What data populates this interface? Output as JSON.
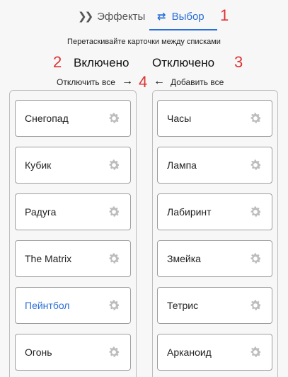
{
  "tabs": [
    {
      "label": "Эффекты",
      "icon": "double-chevron-right-icon"
    },
    {
      "label": "Выбор",
      "icon": "swap-arrows-icon"
    }
  ],
  "hint": "Перетаскивайте карточки между списками",
  "columns": {
    "enabled_title": "Включено",
    "disabled_title": "Отключено",
    "disable_all": "Отключить все",
    "enable_all": "Добавить все"
  },
  "annotations": [
    "1",
    "2",
    "3",
    "4"
  ],
  "enabled_items": [
    {
      "label": "Снегопад"
    },
    {
      "label": "Кубик"
    },
    {
      "label": "Радуга"
    },
    {
      "label": "The Matrix"
    },
    {
      "label": "Пейнтбол",
      "highlighted": true
    },
    {
      "label": "Огонь"
    }
  ],
  "disabled_items": [
    {
      "label": "Часы"
    },
    {
      "label": "Лампа"
    },
    {
      "label": "Лабиринт"
    },
    {
      "label": "Змейка"
    },
    {
      "label": "Тетрис"
    },
    {
      "label": "Арканоид"
    }
  ],
  "colors": {
    "accent": "#2a6fd6",
    "annotation": "#d33",
    "gear": "#bdbdbd"
  }
}
